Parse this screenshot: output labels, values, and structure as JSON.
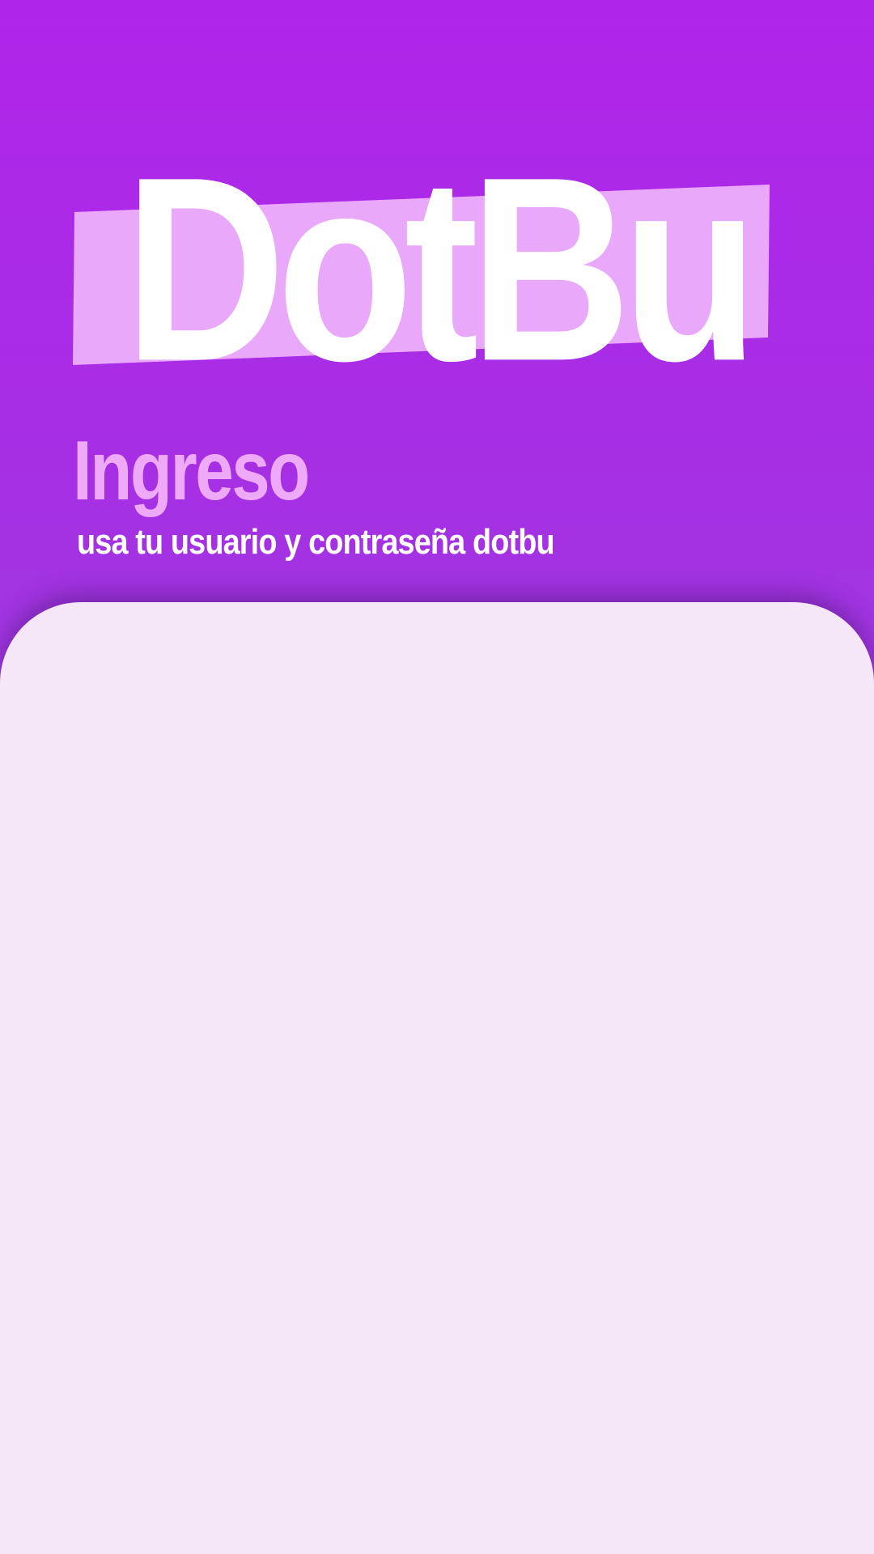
{
  "brand": {
    "logo_text": "DotBu",
    "band_color": "#eaa8fb",
    "logo_color": "#ffffff"
  },
  "header": {
    "title": "Ingreso",
    "subtitle": "usa tu usuario y contraseña dotbu"
  },
  "colors": {
    "gradient_top": "#b025ea",
    "gradient_bottom": "#8a52d6",
    "title_color": "#eeaaf8",
    "card_background": "#f5e7f8"
  }
}
